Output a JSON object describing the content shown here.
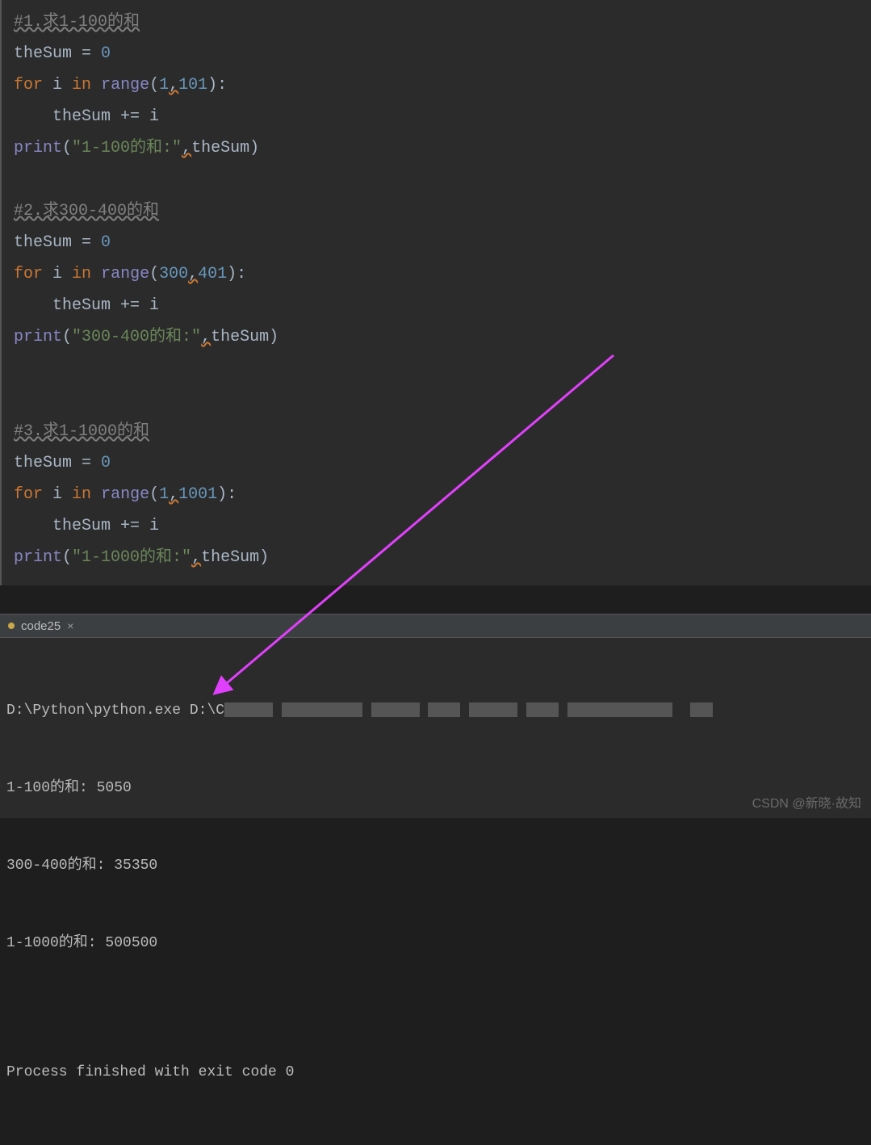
{
  "code": {
    "block1": {
      "comment": "#1.求1-100的和",
      "l1_var": "theSum",
      "l1_op": " = ",
      "l1_num": "0",
      "l2_for": "for",
      "l2_i": " i ",
      "l2_in": "in",
      "l2_sp": " ",
      "l2_range": "range",
      "l2_open": "(",
      "l2_n1": "1",
      "l2_comma": ",",
      "l2_n2": "101",
      "l2_close": "):",
      "l3_indent": "    ",
      "l3_var": "theSum",
      "l3_op": " += i",
      "l4_print": "print",
      "l4_open": "(",
      "l4_str": "\"1-100的和:\"",
      "l4_comma": ",",
      "l4_arg": "theSum",
      "l4_close": ")"
    },
    "block2": {
      "comment": "#2.求300-400的和",
      "l1_var": "theSum",
      "l1_op": " = ",
      "l1_num": "0",
      "l2_for": "for",
      "l2_i": " i ",
      "l2_in": "in",
      "l2_sp": " ",
      "l2_range": "range",
      "l2_open": "(",
      "l2_n1": "300",
      "l2_comma": ",",
      "l2_n2": "401",
      "l2_close": "):",
      "l3_indent": "    ",
      "l3_var": "theSum",
      "l3_op": " += i",
      "l4_print": "print",
      "l4_open": "(",
      "l4_str": "\"300-400的和:\"",
      "l4_comma": ",",
      "l4_arg": "theSum",
      "l4_close": ")"
    },
    "block3": {
      "comment": "#3.求1-1000的和",
      "l1_var": "theSum",
      "l1_op": " = ",
      "l1_num": "0",
      "l2_for": "for",
      "l2_i": " i ",
      "l2_in": "in",
      "l2_sp": " ",
      "l2_range": "range",
      "l2_open": "(",
      "l2_n1": "1",
      "l2_comma": ",",
      "l2_n2": "1001",
      "l2_close": "):",
      "l3_indent": "    ",
      "l3_var": "theSum",
      "l3_op": " += i",
      "l4_print": "print",
      "l4_open": "(",
      "l4_str": "\"1-1000的和:\"",
      "l4_comma": ",",
      "l4_arg": "theSum",
      "l4_close": ")"
    }
  },
  "tab": {
    "name": "code25",
    "close": "×"
  },
  "console": {
    "cmd_prefix": "D:\\Python\\python.exe D:\\C",
    "line1": "1-100的和: 5050",
    "line2": "300-400的和: 35350",
    "line3": "1-1000的和: 500500",
    "blank": "",
    "exit": "Process finished with exit code 0"
  },
  "watermark": "CSDN @新晓·故知"
}
